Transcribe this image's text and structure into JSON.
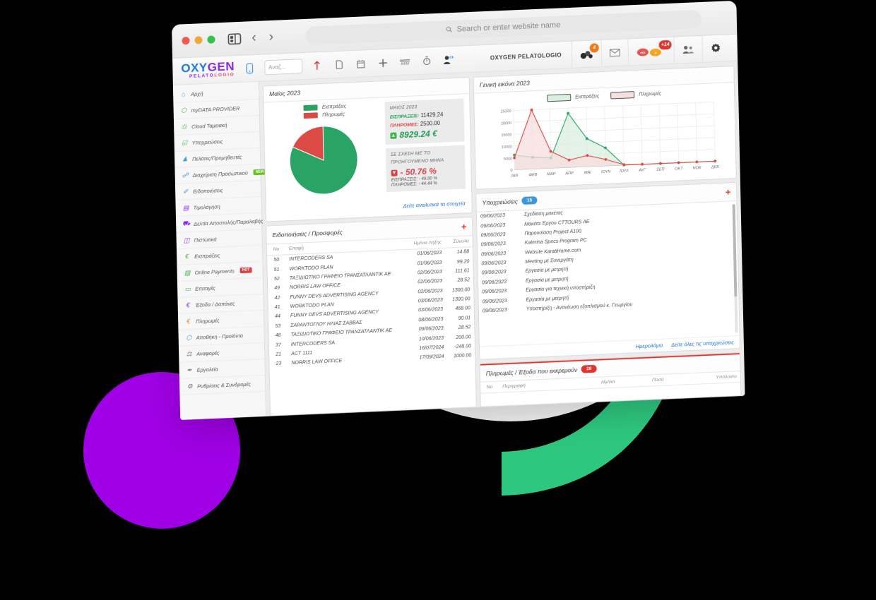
{
  "browser": {
    "search_placeholder": "Search or enter website name",
    "search_icon": "search-icon",
    "back_label": "‹",
    "forward_label": "›",
    "sidebar_toggle_icon": "panel-icon"
  },
  "app": {
    "logo_part1": "OXY",
    "logo_part2": "GEN",
    "logo_sub1": "PELATO",
    "logo_sub2": "LOGIO",
    "brand_text": "OXYGEN PELATOLOGIO",
    "toolbar": {
      "mobile_icon": "mobile-icon",
      "search_value": "Αναζ...",
      "upload_icon": "upload-icon",
      "document_icon": "document-icon",
      "calendar_icon": "calendar-icon",
      "plus_icon": "plus-icon",
      "afm_icon": "afm-icon",
      "timer_icon": "timer-icon",
      "user_on_icon": "user-online-icon"
    },
    "header_right": {
      "tools_badge": "4",
      "mail_icon": "mail-icon",
      "alerts_badge": "+14",
      "users_icon": "users-icon",
      "settings_icon": "gear-icon"
    }
  },
  "sidebar": {
    "items": [
      {
        "label": "Αρχή",
        "icon": "home-icon",
        "icon_glyph": "⌂",
        "color": "#3d97d8",
        "tag": null
      },
      {
        "label": "myDATA PROVIDER",
        "icon": "network-icon",
        "icon_glyph": "⬡",
        "color": "#3bb54a",
        "tag": null
      },
      {
        "label": "Cloud Ταμειακή",
        "icon": "printer-icon",
        "icon_glyph": "⎙",
        "color": "#3bb54a",
        "tag": null
      },
      {
        "label": "Υποχρεώσεις",
        "icon": "checklist-icon",
        "icon_glyph": "☑",
        "color": "#3bb54a",
        "tag": null
      },
      {
        "label": "Πελάτες/Προμηθευτές",
        "icon": "users-icon",
        "icon_glyph": "♟",
        "color": "#3d97d8",
        "tag": null
      },
      {
        "label": "Διαχείριση Προσωπικού",
        "icon": "staff-icon",
        "icon_glyph": "☍",
        "color": "#3d97d8",
        "tag": "NEW",
        "tag_kind": "new"
      },
      {
        "label": "Ειδοποιήσεις",
        "icon": "bell-icon",
        "icon_glyph": "✐",
        "color": "#3d97d8",
        "tag": null
      },
      {
        "label": "Τιμολόγηση",
        "icon": "invoice-icon",
        "icon_glyph": "▤",
        "color": "#8a2be2",
        "tag": null
      },
      {
        "label": "Δελτία Αποστολής/Παραλαβής",
        "icon": "truck-icon",
        "icon_glyph": "⛟",
        "color": "#8a2be2",
        "tag": null
      },
      {
        "label": "Πιστωτικά",
        "icon": "credit-icon",
        "icon_glyph": "◫",
        "color": "#8a2be2",
        "tag": null
      },
      {
        "label": "Εισπράξεις",
        "icon": "euro-icon",
        "icon_glyph": "€",
        "color": "#3bb54a",
        "tag": null
      },
      {
        "label": "Online Payments",
        "icon": "card-icon",
        "icon_glyph": "▨",
        "color": "#3bb54a",
        "tag": "HOT",
        "tag_kind": "hot"
      },
      {
        "label": "Επιταγές",
        "icon": "cheque-icon",
        "icon_glyph": "▭",
        "color": "#3bb54a",
        "tag": null
      },
      {
        "label": "Έξοδα / Δαπάνες",
        "icon": "euro-icon",
        "icon_glyph": "€",
        "color": "#8a2be2",
        "tag": null
      },
      {
        "label": "Πληρωμές",
        "icon": "euro-icon",
        "icon_glyph": "€",
        "color": "#e08a2b",
        "tag": null
      },
      {
        "label": "Αποθήκη - Προϊόντα",
        "icon": "box-icon",
        "icon_glyph": "⬡",
        "color": "#3d97d8",
        "tag": null
      },
      {
        "label": "Αναφορές",
        "icon": "scale-icon",
        "icon_glyph": "⚖",
        "color": "#777777",
        "tag": null
      },
      {
        "label": "Εργαλεία",
        "icon": "pencil-icon",
        "icon_glyph": "✒",
        "color": "#777777",
        "tag": null
      },
      {
        "label": "Ρυθμίσεις & Συνδρομές",
        "icon": "gear-icon",
        "icon_glyph": "⚙",
        "color": "#777777",
        "tag": null
      }
    ]
  },
  "pie_card": {
    "title": "Μαϊος 2023",
    "legend": [
      {
        "label": "Εισπράξεις",
        "color": "#2aa464"
      },
      {
        "label": "Πληρωμές",
        "color": "#dc4a45"
      }
    ],
    "stat_month_label": "ΜΑΙΟΣ 2023",
    "income_label": "ΕΙΣΠΡΑΞΕΙΣ:",
    "income_value": "11429.24",
    "payments_label": "ΠΛΗΡΟΜΕΣ:",
    "payments_value": "2500.00",
    "net_value": "8929.24 €",
    "compare_title_line1": "ΣΕ ΣΧΕΣΗ ΜΕ ΤΟ",
    "compare_title_line2": "ΠΡΟΗΓΟΥΜΕΝΟ ΜΗΝΑ",
    "compare_value": "- 50.76 %",
    "compare_income": "ΕΙΣΠΡΑΞΕΙΣ: - 49.50 %",
    "compare_payments": "ΠΛΗΡΟΜΕΣ: - 44.44 %",
    "footer_link": "Δείτε αναλυτικά τα στοιχεία"
  },
  "notifications_card": {
    "title": "Ειδοποιήσεις / Προσφορές",
    "add_icon": "plus-icon",
    "columns": [
      "No",
      "Επαφή",
      "Ημ/νια Λήξης",
      "Σύνολα"
    ],
    "rows": [
      [
        "50",
        "INTERCODERS SA",
        "01/06/2023",
        "14.88"
      ],
      [
        "51",
        "WORKTODO PLAN",
        "01/06/2023",
        "99.20"
      ],
      [
        "52",
        "ΤΑΞΙΔΙΩΤΙΚΟ ΓΡΑΦΕΙΟ ΤΡΑΝΣΑΤΛΑΝΤΙΚ ΑΕ",
        "02/06/2023",
        "111.61"
      ],
      [
        "49",
        "NORRIS LAW OFFICE",
        "02/06/2023",
        "28.52"
      ],
      [
        "42",
        "FUNNY DEVS ADVERTISING AGENCY",
        "02/06/2023",
        "1300.00"
      ],
      [
        "41",
        "WORKTODO PLAN",
        "03/06/2023",
        "1300.00"
      ],
      [
        "44",
        "FUNNY DEVS ADVERTISING AGENCY",
        "03/06/2023",
        "468.00"
      ],
      [
        "53",
        "ΣΑΡΑΝΤΟΓΛΟΥ ΗΛΙΑΣ ΣΑΒΒΑΣ",
        "08/06/2023",
        "90.01"
      ],
      [
        "48",
        "ΤΑΞΙΔΙΩΤΙΚΟ ΓΡΑΦΕΙΟ ΤΡΑΝΣΑΤΛΑΝΤΙΚ ΑΕ",
        "09/06/2023",
        "28.52"
      ],
      [
        "37",
        "INTERCODERS SA",
        "10/06/2023",
        "200.00"
      ],
      [
        "21",
        "ACT 1111",
        "16/07/2024",
        "-248.00"
      ],
      [
        "23",
        "NORRIS LAW OFFICE",
        "17/09/2024",
        "1000.00"
      ]
    ]
  },
  "chart_card": {
    "title": "Γενική εικόνα 2023"
  },
  "obligations_card": {
    "title": "Υποχρεώσεις",
    "count": "15",
    "add_icon": "plus-icon",
    "rows": [
      [
        "09/06/2023",
        "Σχεδίαση μακέτας"
      ],
      [
        "09/06/2023",
        "Μακέτα Έργου CTTOURS AE"
      ],
      [
        "09/06/2023",
        "Παρουσίαση Project A100"
      ],
      [
        "09/06/2023",
        "Katerina Specs Program PC"
      ],
      [
        "09/06/2023",
        "Website KaratiHome.com"
      ],
      [
        "09/06/2023",
        "Meeting με Συνεργάτη"
      ],
      [
        "09/06/2023",
        "Εργασία με μετρητή"
      ],
      [
        "09/06/2023",
        "Εργασία με μετρητή"
      ],
      [
        "09/06/2023",
        "Εργασία για τεχνική υποστήριξη"
      ],
      [
        "09/06/2023",
        "Εργασία με μετρητή"
      ],
      [
        "09/06/2023",
        "Υποστήριξη - Ανανέωση εξοπλισμού κ. Γεωργίου"
      ]
    ],
    "footer_links": [
      "Ημερολόγιο",
      "Δείτε όλες τις υποχρεώσεις"
    ]
  },
  "payments_card": {
    "title": "Πληρωμές / Έξοδα που εκκρεμούν",
    "count": "28",
    "columns": [
      "No",
      "Περιγραφή",
      "Ημ/νια",
      "Ποσό",
      "Υπόλοιπο"
    ]
  },
  "colors": {
    "green": "#2aa464",
    "red": "#dc4a45",
    "blue": "#1f6fcc",
    "accent_purple": "#a000e6",
    "accent_green": "#2ec77f",
    "accent_lilac": "#d7c9fb",
    "accent_red": "#e64b57"
  },
  "chart_data": {
    "type": "area",
    "title": "Γενική εικόνα 2023",
    "categories": [
      "ΙΑΝ",
      "ΦΕΒ",
      "ΜΑΡ",
      "ΑΠΡ",
      "ΜΑΙ",
      "ΙΟΥΝ",
      "ΙΟΥΛ",
      "ΑΥΓ",
      "ΣΕΠ",
      "ΟΚΤ",
      "ΝΟΕ",
      "ΔΕΚ"
    ],
    "series": [
      {
        "name": "Εισπράξεις",
        "color": "#2aa464",
        "fill": "#d9efe0",
        "values": [
          6200,
          4900,
          4300,
          22800,
          11800,
          7600,
          0,
          0,
          0,
          0,
          0,
          0
        ]
      },
      {
        "name": "Πληρωμές",
        "color": "#dc4a45",
        "fill": "#f7dedf",
        "values": [
          5000,
          24900,
          7100,
          3100,
          4700,
          2700,
          200,
          0,
          0,
          0,
          0,
          0
        ]
      }
    ],
    "ylim": [
      0,
      25000
    ],
    "yticks": [
      0,
      5000,
      10000,
      15000,
      20000,
      25000
    ],
    "ylabel": "",
    "xlabel": "",
    "grid": true,
    "legend_position": "top-center"
  },
  "pie_chart_data": {
    "type": "pie",
    "title": "Μαϊος 2023",
    "labels": [
      "Εισπράξεις",
      "Πληρωμές"
    ],
    "values": [
      11429.24,
      2500.0
    ],
    "percentages": [
      82.05,
      17.95
    ],
    "colors": [
      "#2aa464",
      "#dc4a45"
    ]
  }
}
